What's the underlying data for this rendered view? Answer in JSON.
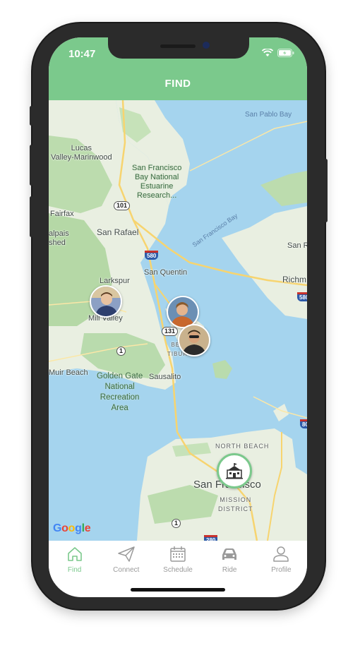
{
  "status_bar": {
    "time": "10:47"
  },
  "header": {
    "title": "FIND"
  },
  "map": {
    "labels": {
      "san_pablo_bay": "San Pablo Bay",
      "lucas_valley": "Lucas\nValley-Marinwood",
      "sf_bay_refuge": "San Francisco\nBay National\nEstuarine\nResearch...",
      "fairfax": "Fairfax",
      "alpais": "alpais\nshed",
      "san_rafael": "San Rafael",
      "sf_bay": "San Francisco Bay",
      "san_r": "San R",
      "san_quentin": "San Quentin",
      "larkspur": "Larkspur",
      "richmond": "Richm",
      "mill_valley": "Mill Valley",
      "belvedere_tiburon": "BEL\nTIBUR",
      "muir_beach": "Muir Beach",
      "golden_gate": "Golden Gate\nNational\nRecreation\nArea",
      "sausalito": "Sausalito",
      "north_beach": "NORTH BEACH",
      "san_francisco": "San Francisco",
      "mission_district": "MISSION\nDISTRICT"
    },
    "shields": {
      "hwy101": "101",
      "i580": "580",
      "hwy131": "131",
      "hwy1a": "1",
      "hwy1b": "1",
      "i580b": "580",
      "i80": "80",
      "i280": "280"
    },
    "attribution": "Google"
  },
  "tabs": [
    {
      "label": "Find",
      "icon": "home-icon",
      "active": true
    },
    {
      "label": "Connect",
      "icon": "paper-plane-icon",
      "active": false
    },
    {
      "label": "Schedule",
      "icon": "calendar-icon",
      "active": false
    },
    {
      "label": "Ride",
      "icon": "car-icon",
      "active": false
    },
    {
      "label": "Profile",
      "icon": "person-icon",
      "active": false
    }
  ],
  "colors": {
    "accent": "#7bc98c",
    "water": "#a5d4ee",
    "land": "#e8efe1",
    "park": "#b9dbad",
    "inactive_tab": "#9a9a9a"
  }
}
